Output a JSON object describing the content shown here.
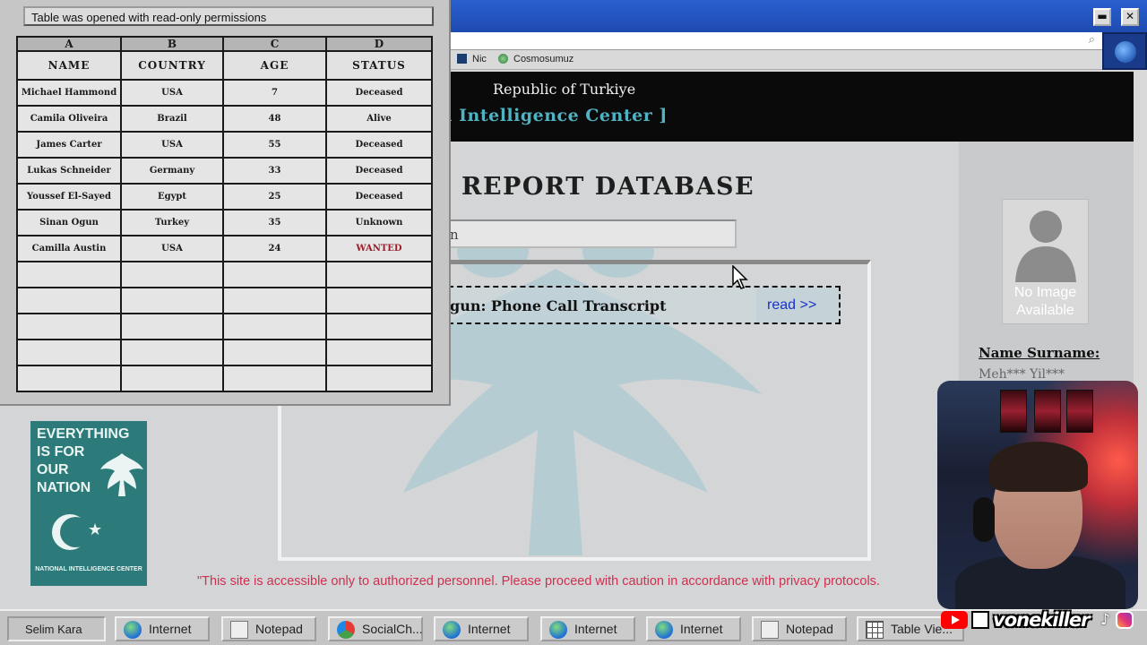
{
  "browser": {
    "bookmarks": [
      {
        "label": "Nic",
        "icon": "nic-icon"
      },
      {
        "label": "Cosmosumuz",
        "icon": "cosmos-globe-icon"
      }
    ],
    "search_icon": "magnifier-icon",
    "window_controls": {
      "minimize": "▬",
      "close": "✕"
    }
  },
  "site": {
    "subtitle": "Republic of Turkiye",
    "title": "tional Intelligence Center ]",
    "heading": "REPORT DATABASE",
    "search_value": "n",
    "result": {
      "title": "gun: Phone Call Transcript",
      "link": "read >>"
    },
    "profile": {
      "placeholder": "No Image Available",
      "name_label": "Name Surname:",
      "name_value": "Meh*** Yil***"
    },
    "notice": "\"This site is accessible only to authorized personnel. Please proceed with caution in accordance with privacy protocols.",
    "poster": {
      "headline": "EVERYTHING\nIS FOR\nOUR\nNATION",
      "footer": "NATIONAL INTELLIGENCE CENTER"
    }
  },
  "sheet": {
    "title": "Table was opened with read-only permissions",
    "column_letters": [
      "A",
      "B",
      "C",
      "D"
    ],
    "headers": [
      "NAME",
      "COUNTRY",
      "AGE",
      "STATUS"
    ],
    "rows": [
      [
        "Michael Hammond",
        "USA",
        "7",
        "Deceased"
      ],
      [
        "Camila Oliveira",
        "Brazil",
        "48",
        "Alive"
      ],
      [
        "James Carter",
        "USA",
        "55",
        "Deceased"
      ],
      [
        "Lukas Schneider",
        "Germany",
        "33",
        "Deceased"
      ],
      [
        "Youssef El-Sayed",
        "Egypt",
        "25",
        "Deceased"
      ],
      [
        "Sinan Ogun",
        "Turkey",
        "35",
        "Unknown"
      ],
      [
        "Camilla Austin",
        "USA",
        "24",
        "WANTED"
      ],
      [
        "",
        "",
        "",
        ""
      ],
      [
        "",
        "",
        "",
        ""
      ],
      [
        "",
        "",
        "",
        ""
      ],
      [
        "",
        "",
        "",
        ""
      ],
      [
        "",
        "",
        "",
        ""
      ]
    ],
    "highlight_color": "#9a1e2a"
  },
  "taskbar": {
    "user": "Selim Kara",
    "items": [
      {
        "label": "Internet",
        "icon": "globe-icon"
      },
      {
        "label": "Notepad",
        "icon": "notepad-icon"
      },
      {
        "label": "SocialCh...",
        "icon": "social-icon"
      },
      {
        "label": "Internet",
        "icon": "globe-icon"
      },
      {
        "label": "Internet",
        "icon": "globe-icon"
      },
      {
        "label": "Internet",
        "icon": "globe-icon"
      },
      {
        "label": "Notepad",
        "icon": "notepad-icon"
      },
      {
        "label": "Table Vie...",
        "icon": "table-icon"
      }
    ]
  },
  "overlay": {
    "handle": "vonekiller",
    "tiktok_glyph": "♪"
  }
}
